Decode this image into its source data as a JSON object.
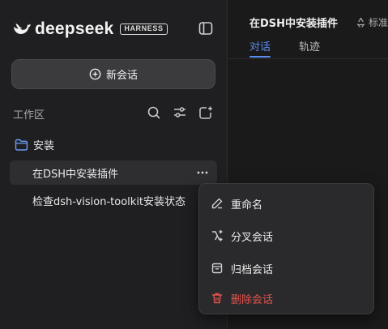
{
  "sidebar": {
    "brand": {
      "name": "deepseek",
      "badge": "HARNESS"
    },
    "new_chat_label": "新会话",
    "workspace_label": "工作区",
    "folder": {
      "name": "安装"
    },
    "chats": [
      {
        "title": "在DSH中安装插件",
        "active": true
      },
      {
        "title": "检查dsh-vision-toolkit安装状态",
        "active": false
      }
    ]
  },
  "main": {
    "title": "在DSH中安装插件",
    "mode_label": "标准",
    "tabs": [
      {
        "label": "对话",
        "active": true
      },
      {
        "label": "轨迹",
        "active": false
      }
    ]
  },
  "context_menu": {
    "items": [
      {
        "label": "重命名",
        "icon": "pencil-icon"
      },
      {
        "label": "分叉会话",
        "icon": "fork-icon"
      },
      {
        "label": "归档会话",
        "icon": "archive-icon"
      },
      {
        "label": "删除会话",
        "icon": "trash-icon",
        "danger": true
      }
    ]
  },
  "colors": {
    "accent": "#5b8def",
    "danger": "#e5534b",
    "background": "#1c1c1e"
  }
}
